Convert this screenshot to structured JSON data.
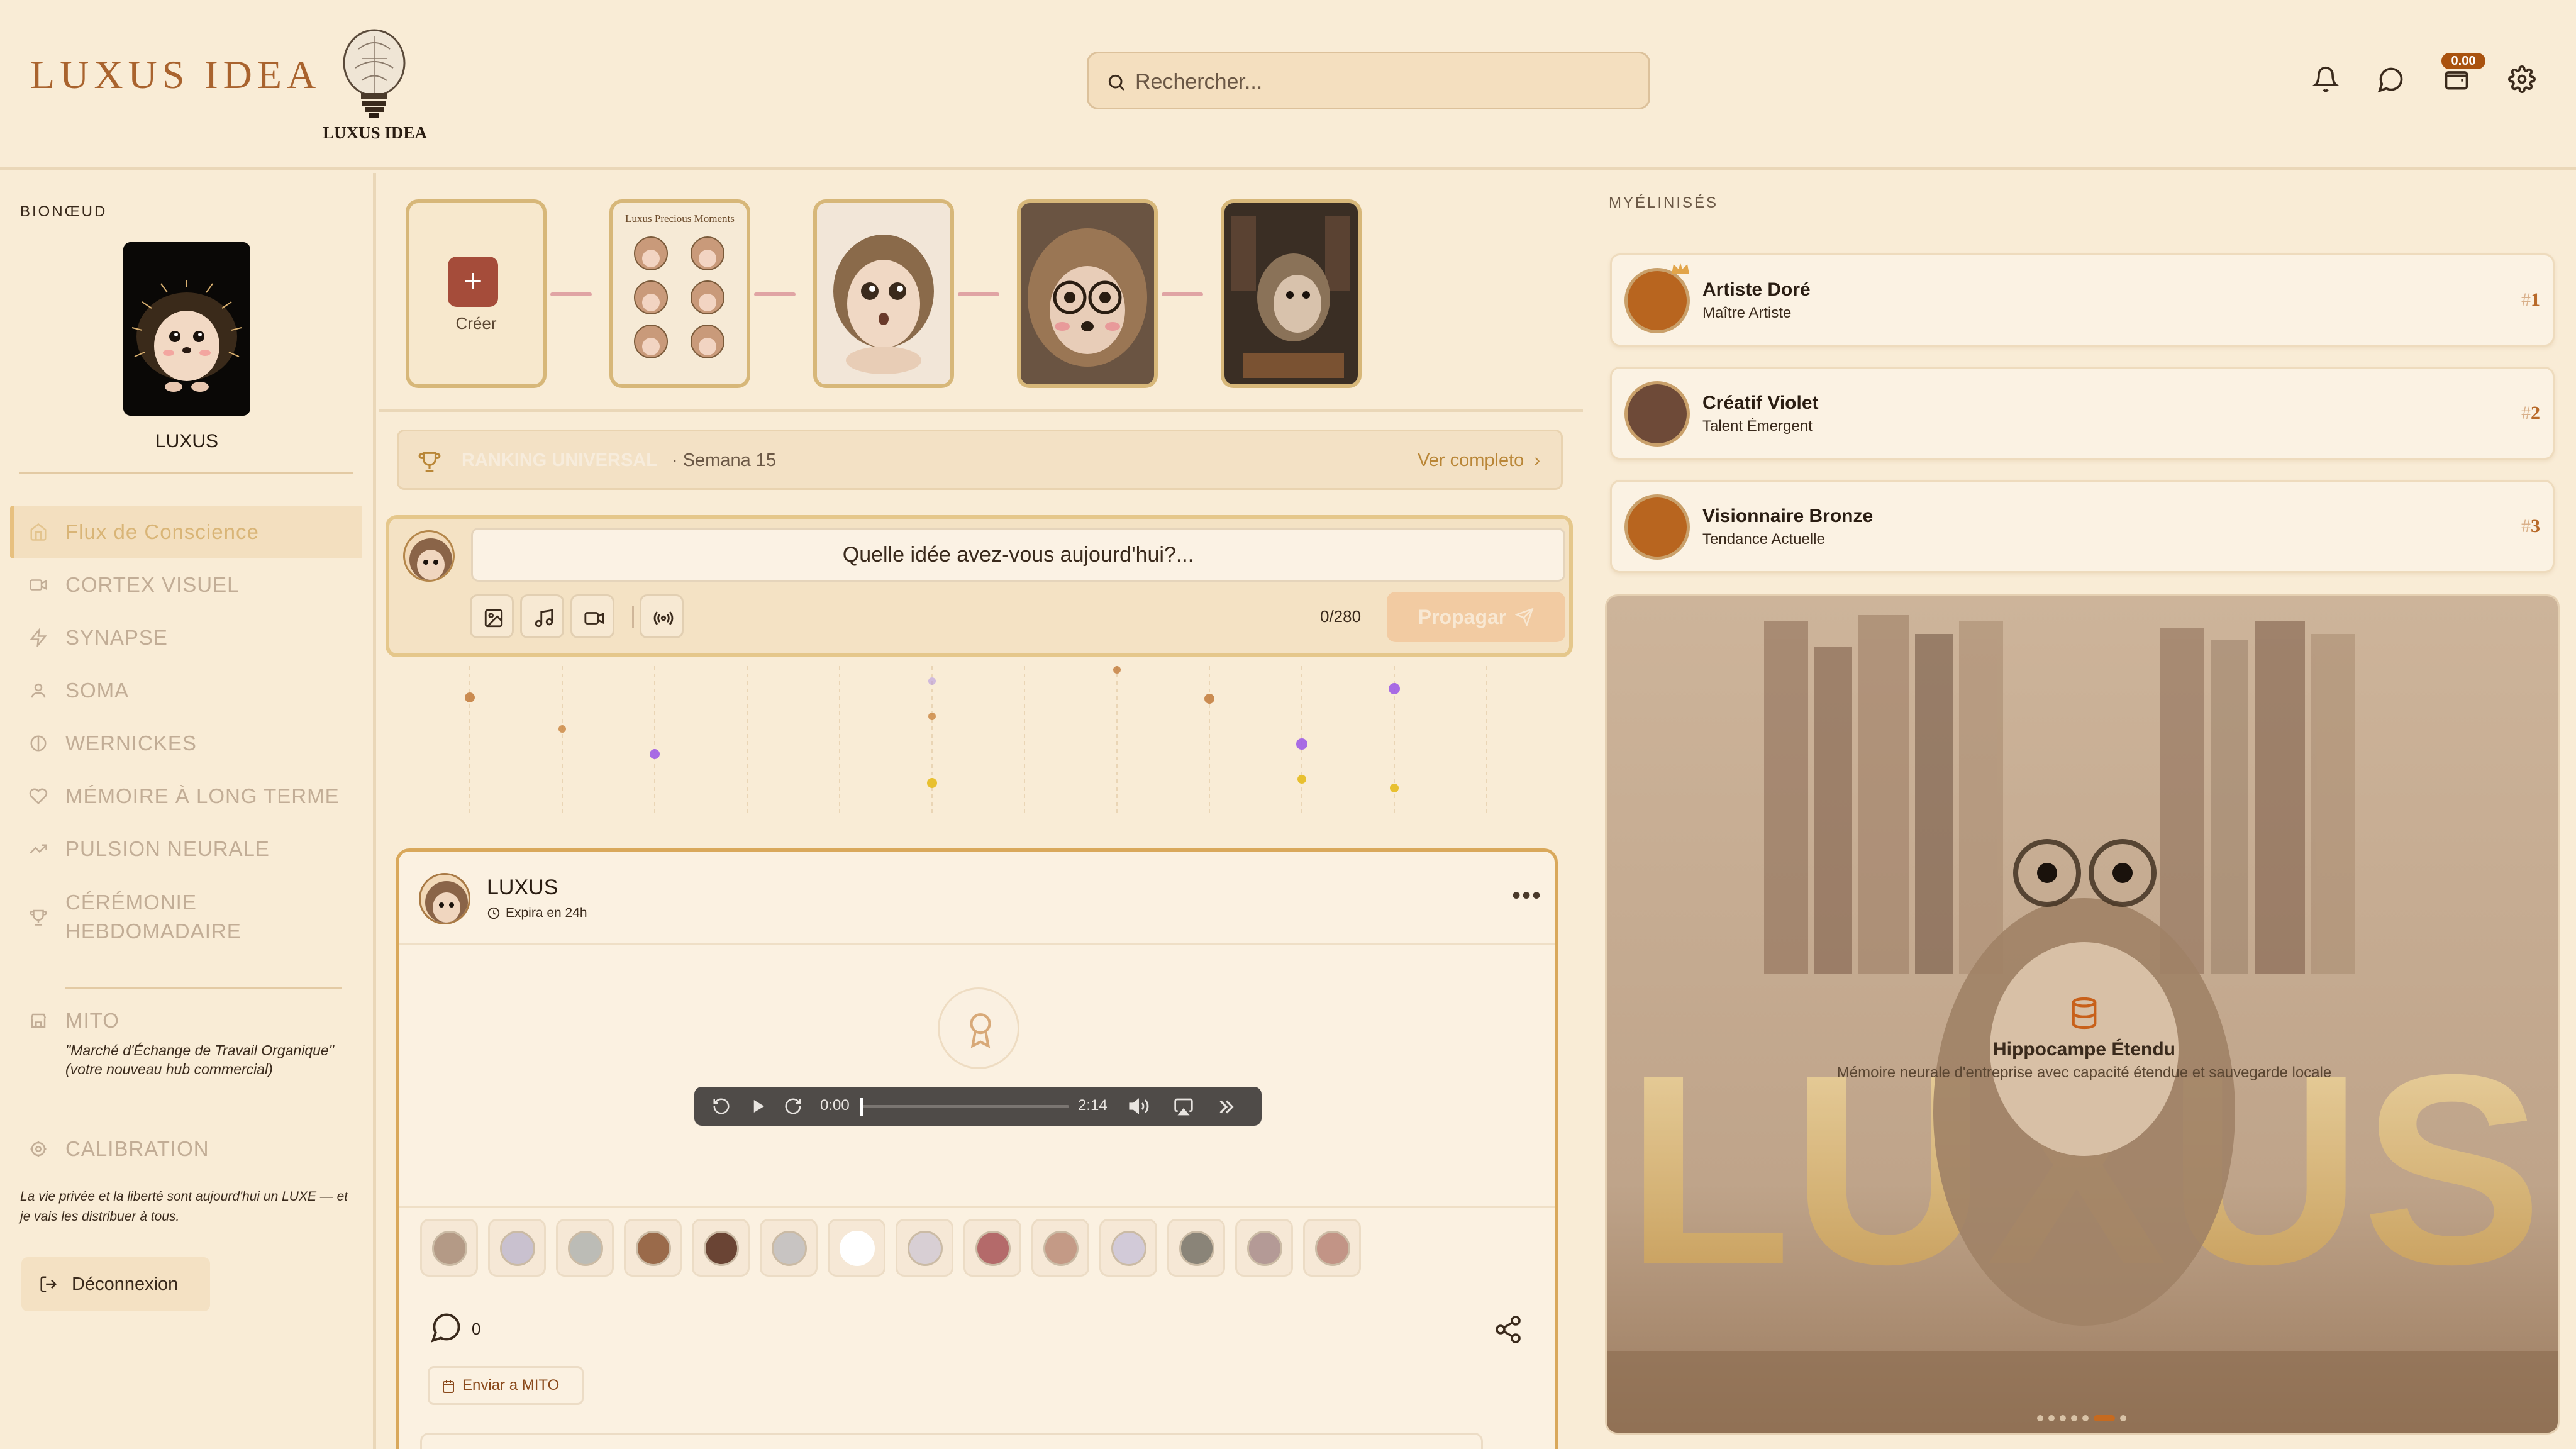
{
  "header": {
    "logo_text": "LUXUS IDEA",
    "logo_subtitle": "LUXUS IDEA",
    "search_placeholder": "Rechercher...",
    "wallet_balance": "0.00"
  },
  "sidebar": {
    "section_title": "BIONŒUD",
    "profile_name": "LUXUS",
    "nav": [
      {
        "label": "Flux de Conscience",
        "icon": "home-icon",
        "active": true
      },
      {
        "label": "CORTEX VISUEL",
        "icon": "video-icon"
      },
      {
        "label": "SYNAPSE",
        "icon": "lightning-icon"
      },
      {
        "label": "SOMA",
        "icon": "user-icon"
      },
      {
        "label": "WERNICKES",
        "icon": "circle-icon"
      },
      {
        "label": "MÉMOIRE À LONG TERME",
        "icon": "heart-icon"
      },
      {
        "label": "PULSION NEURALE",
        "icon": "trending-icon"
      },
      {
        "label": "CÉRÉMONIE HEBDOMADAIRE",
        "icon": "trophy-icon"
      }
    ],
    "mito_label": "MITO",
    "mito_subtitle_1": "\"Marché d'Échange de Travail Organique\"",
    "mito_subtitle_2": "(votre nouveau hub commercial)",
    "calibration_label": "CALIBRATION",
    "privacy_text": "La vie privée et la liberté sont aujourd'hui un LUXE — et je vais les distribuer à tous.",
    "logout_label": "Déconnexion"
  },
  "stories": {
    "create_label": "Créer",
    "items": [
      {
        "title": "Luxus Precious Moments"
      },
      {
        "title": ""
      },
      {
        "title": ""
      },
      {
        "title": ""
      }
    ]
  },
  "ranking": {
    "label": "RANKING UNIVERSAL",
    "week": "· Semana 15",
    "link": "Ver completo"
  },
  "composer": {
    "placeholder": "Quelle idée avez-vous aujourd'hui?...",
    "counter": "0/280",
    "submit_label": "Propagar"
  },
  "post": {
    "author": "LUXUS",
    "expiry": "Expira en 24h",
    "audio_current": "0:00",
    "audio_duration": "2:14",
    "audio_progress": 0,
    "comment_count": "0",
    "send_label": "Enviar a MITO"
  },
  "right_panel": {
    "title": "MYÉLINISÉS",
    "ranking": [
      {
        "name": "Artiste Doré",
        "subtitle": "Maître Artiste",
        "rank": "1",
        "color": "#b8651f"
      },
      {
        "name": "Créatif Violet",
        "subtitle": "Talent Émergent",
        "rank": "2",
        "color": "#6e4a38"
      },
      {
        "name": "Visionnaire Bronze",
        "subtitle": "Tendance Actuelle",
        "rank": "3",
        "color": "#b8651f"
      }
    ],
    "feature_title": "Hippocampe Étendu",
    "feature_desc": "Mémoire neurale d'entreprise avec capacité étendue et sauvegarde locale",
    "feature_banner_text": "LUXUS",
    "carousel_active_index": 5,
    "carousel_count": 7
  },
  "colors": {
    "background": "#f9ecd6",
    "accent": "#a9632e",
    "active_nav": "#d9b577"
  }
}
